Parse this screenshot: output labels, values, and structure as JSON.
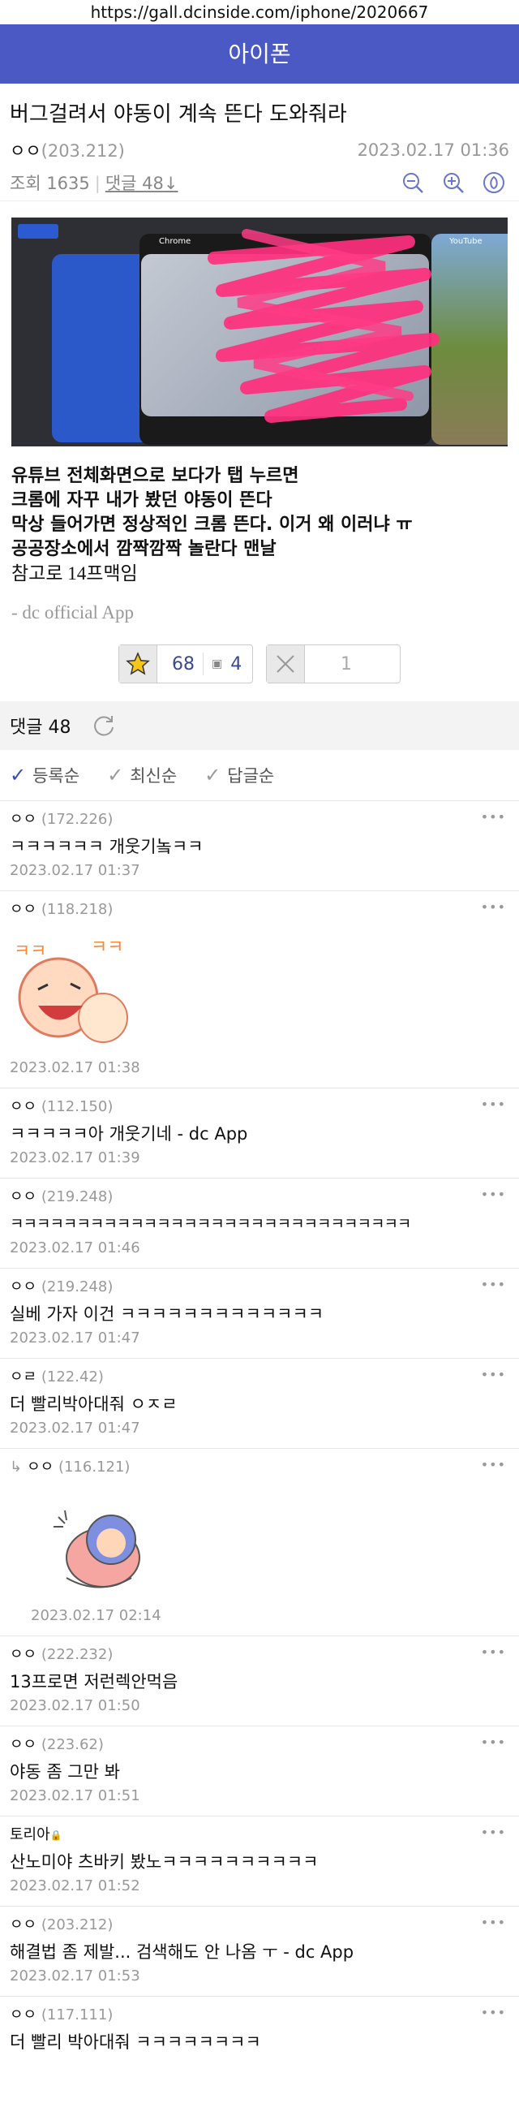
{
  "browser": {
    "url": "https://gall.dcinside.com/iphone/2020667"
  },
  "header": {
    "title": "아이폰"
  },
  "post": {
    "title": "버그걸려서 야동이 계속 뜬다 도와줘라",
    "author": "ㅇㅇ",
    "author_ip": "(203.212)",
    "date": "2023.02.17 01:36",
    "views_label": "조회 1635",
    "comments_label": "댓글 48",
    "image_labels": {
      "chrome": "Chrome",
      "youtube": "YouTube"
    },
    "body_lines": [
      "유튜브 전체화면으로 보다가 탭 누르면",
      "크롬에 자꾸 내가 봤던 야동이 뜬다",
      "막상 들어가면 정상적인 크롬 뜬다. 이거 왜 이러냐 ㅠ",
      "공공장소에서 깜짝깜짝 놀란다 맨날"
    ],
    "body_last_line": "참고로 14프맥임",
    "footer_text": "- dc official App",
    "votes": {
      "up": "68",
      "fixed": "4",
      "down": "1"
    }
  },
  "comments_section": {
    "label": "댓글 48",
    "sort_options": [
      "등록순",
      "최신순",
      "답글순"
    ]
  },
  "comments": [
    {
      "nick": "ㅇㅇ",
      "ip": "(172.226)",
      "text": "ㅋㅋㅋㅋㅋㅋ 개웃기놐ㅋㅋ",
      "date": "2023.02.17 01:37"
    },
    {
      "nick": "ㅇㅇ",
      "ip": "(118.218)",
      "text": "",
      "date": "2023.02.17 01:38"
    },
    {
      "nick": "ㅇㅇ",
      "ip": "(112.150)",
      "text": "ㅋㅋㅋㅋㅋ아 개웃기네 - dc App",
      "date": "2023.02.17 01:39"
    },
    {
      "nick": "ㅇㅇ",
      "ip": "(219.248)",
      "text": "ㅋㅋㅋㅋㅋㅋㅋㅋㅋㅋㅋㅋㅋㅋㅋㅋㅋㅋㅋㅋㅋㅋㅋㅋㅋㅋㅋㅋㅋㅋ",
      "date": "2023.02.17 01:46"
    },
    {
      "nick": "ㅇㅇ",
      "ip": "(219.248)",
      "text": "실베 가자 이건 ㅋㅋㅋㅋㅋㅋㅋㅋㅋㅋㅋㅋㅋ",
      "date": "2023.02.17 01:47"
    },
    {
      "nick": "ㅇㄹ",
      "ip": "(122.42)",
      "text": "더 빨리박아대줘 ㅇㅈㄹ",
      "date": "2023.02.17 01:47"
    },
    {
      "nick": "ㅇㅇ",
      "ip": "(116.121)",
      "text": "",
      "date": "2023.02.17 02:14"
    },
    {
      "nick": "ㅇㅇ",
      "ip": "(222.232)",
      "text": "13프로면 저런렉안먹음",
      "date": "2023.02.17 01:50"
    },
    {
      "nick": "ㅇㅇ",
      "ip": "(223.62)",
      "text": "야동 좀 그만 봐",
      "date": "2023.02.17 01:51"
    },
    {
      "nick": "토리아",
      "ip": "",
      "text": "산노미야 츠바키 봤노ㅋㅋㅋㅋㅋㅋㅋㅋㅋㅋ",
      "date": "2023.02.17 01:52"
    },
    {
      "nick": "ㅇㅇ",
      "ip": "(203.212)",
      "text": "해결법 좀 제발... 검색해도 안 나옴 ㅜ - dc App",
      "date": "2023.02.17 01:53"
    },
    {
      "nick": "ㅇㅇ",
      "ip": "(117.111)",
      "text": "더 빨리 박아대줘 ㅋㅋㅋㅋㅋㅋㅋㅋ",
      "date": ""
    }
  ],
  "colors": {
    "header_bg": "#4b59c4",
    "accent_check": "#3b4bb8",
    "vote_text": "#3b4890"
  },
  "icons": [
    "zoom-out-icon",
    "zoom-in-icon",
    "share-icon",
    "star-icon",
    "refresh-icon",
    "x-icon",
    "more-icon",
    "reply-arrow-icon",
    "check-icon"
  ]
}
